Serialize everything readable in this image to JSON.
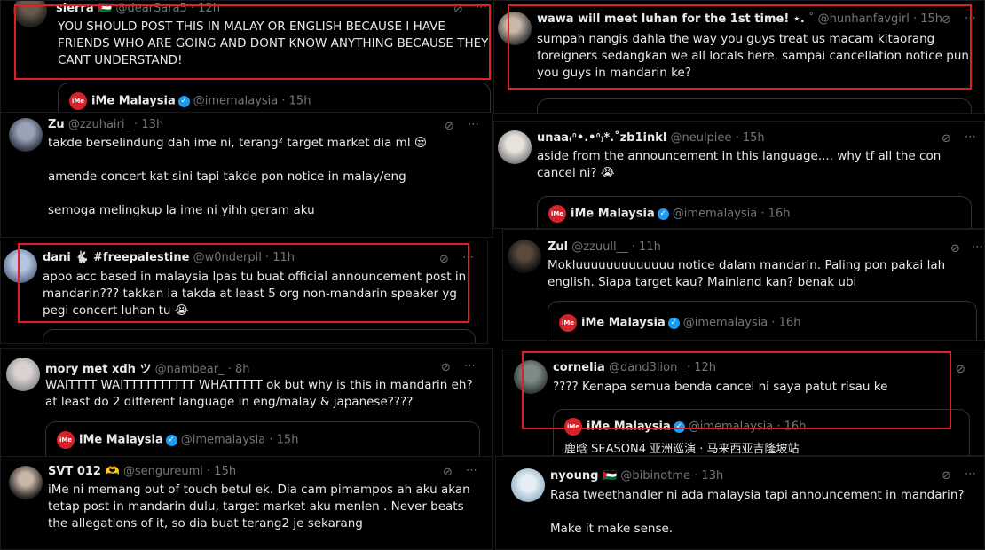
{
  "quote_account": {
    "name": "iMe Malaysia",
    "handle": "@imemalaysia",
    "logo_text": "iMe"
  },
  "colors": {
    "highlight": "#e01e23",
    "verified": "#1d9bf0",
    "logo": "#d4232a"
  },
  "tweets": [
    {
      "name": "sierra 🇵🇸",
      "handle": "@dearSara5",
      "time": "· 12h",
      "text": "YOU SHOULD POST THIS IN MALAY OR ENGLISH BECAUSE I HAVE FRIENDS WHO ARE GOING AND DONT KNOW ANYTHING BECAUSE THEY CANT UNDERSTAND!",
      "quote_time": "· 15h"
    },
    {
      "name": "wawa will meet luhan for the 1st time! ⋆.",
      "handle": "˚ @hunhanfavgirl",
      "time": "· 15h",
      "text": "sumpah nangis dahla the way you guys treat us macam kitaorang foreigners sedangkan we all locals here, sampai cancellation notice pun you guys in mandarin ke?"
    },
    {
      "name": "Zu",
      "handle": "@zzuhairi_",
      "time": "· 13h",
      "text": "takde berselindung dah ime ni, terang² target market dia ml 😒\n\namende concert kat sini tapi takde pon notice in malay/eng\n\nsemoga melingkup la ime ni yihh geram aku"
    },
    {
      "name": "unaa₍ᐢ•.•ᐢ₎*.˚zb1inkl",
      "handle": "@neulpiee",
      "time": "· 15h",
      "text": "aside from the announcement in this language.... why tf all the con cancel ni? 😭",
      "quote_time": "· 16h"
    },
    {
      "name": "dani 🐇 #freepalestine",
      "handle": "@w0nderpil",
      "time": "· 11h",
      "text": "apoo acc based in malaysia lpas tu buat official announcement post in mandarin??? takkan la takda at least 5 org non-mandarin speaker yg pegi concert luhan tu 😭"
    },
    {
      "name": "Zul",
      "handle": "@zzuull__",
      "time": "· 11h",
      "text": "Mokluuuuuuuuuuuuu notice dalam mandarin. Paling pon pakai lah english. Siapa target kau? Mainland kan? benak ubi",
      "quote_time": "· 16h"
    },
    {
      "name": "mory met xdh ツ",
      "handle": "@nambear_",
      "time": "· 8h",
      "text": "WAITTTT WAITTTTTTTTTT WHATTTTT ok but why is this in mandarin eh? at least do 2 different language in eng/malay & japanese????",
      "quote_time": "· 15h"
    },
    {
      "name": "cornelia",
      "handle": "@dand3lion_",
      "time": "· 12h",
      "text": "???? Kenapa semua benda cancel ni saya patut risau ke",
      "quote_time": "· 16h",
      "quote_text": "鹿晗 SEASON4 亚洲巡演 · 马来西亚吉隆坡站"
    },
    {
      "name": "SVT 012 🫶",
      "handle": "@sengureumi",
      "time": "· 15h",
      "text": "iMe ni memang out of touch betul ek. Dia cam pimampos ah aku akan tetap post in mandarin dulu, target market aku menlen . Never beats the allegations of it, so dia buat terang2 je sekarang"
    },
    {
      "name": "nyoung 🇵🇸",
      "handle": "@bibinotme",
      "time": "· 13h",
      "text": "Rasa tweethandler ni ada malaysia tapi announcement in mandarin?\n\nMake it make sense."
    }
  ]
}
